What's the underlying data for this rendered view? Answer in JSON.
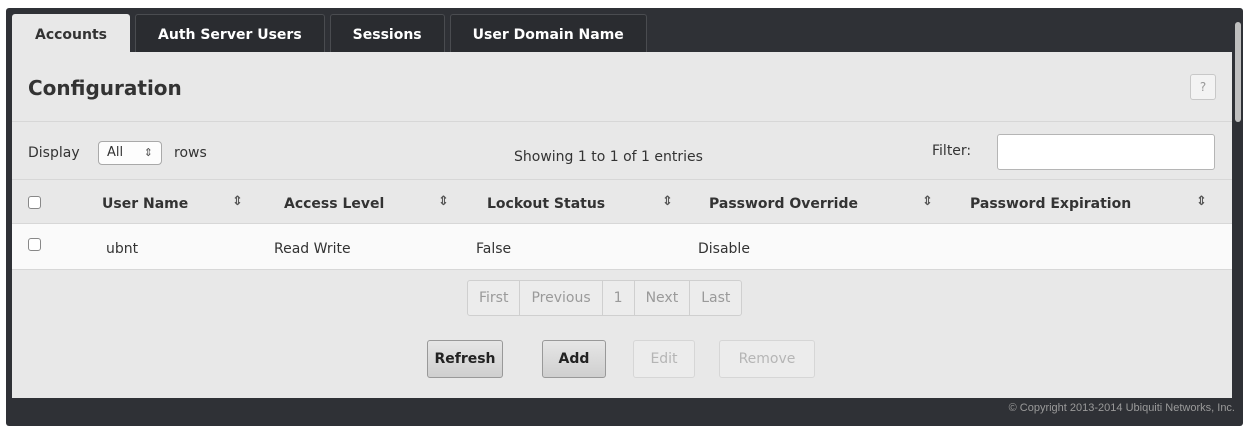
{
  "tabs": [
    {
      "label": "Accounts",
      "active": true
    },
    {
      "label": "Auth Server Users",
      "active": false
    },
    {
      "label": "Sessions",
      "active": false
    },
    {
      "label": "User Domain Name",
      "active": false
    }
  ],
  "panel": {
    "title": "Configuration",
    "help_label": "?"
  },
  "controls": {
    "display_label": "Display",
    "display_value": "All",
    "rows_label": "rows",
    "showing_text": "Showing 1 to 1 of 1 entries",
    "filter_label": "Filter:",
    "filter_value": ""
  },
  "table": {
    "columns": [
      "User Name",
      "Access Level",
      "Lockout Status",
      "Password Override",
      "Password Expiration"
    ],
    "rows": [
      {
        "user_name": "ubnt",
        "access_level": "Read Write",
        "lockout_status": "False",
        "password_override": "Disable",
        "password_expiration": "",
        "checked": false
      }
    ]
  },
  "pagination": {
    "first": "First",
    "previous": "Previous",
    "page": "1",
    "next": "Next",
    "last": "Last"
  },
  "buttons": {
    "refresh": "Refresh",
    "add": "Add",
    "edit": "Edit",
    "remove": "Remove"
  },
  "footer": {
    "copyright": "© Copyright 2013-2014 Ubiquiti Networks, Inc."
  },
  "icons": {
    "sort": "sort-icon",
    "select_arrows": "select-arrows-icon",
    "help": "help-icon"
  }
}
